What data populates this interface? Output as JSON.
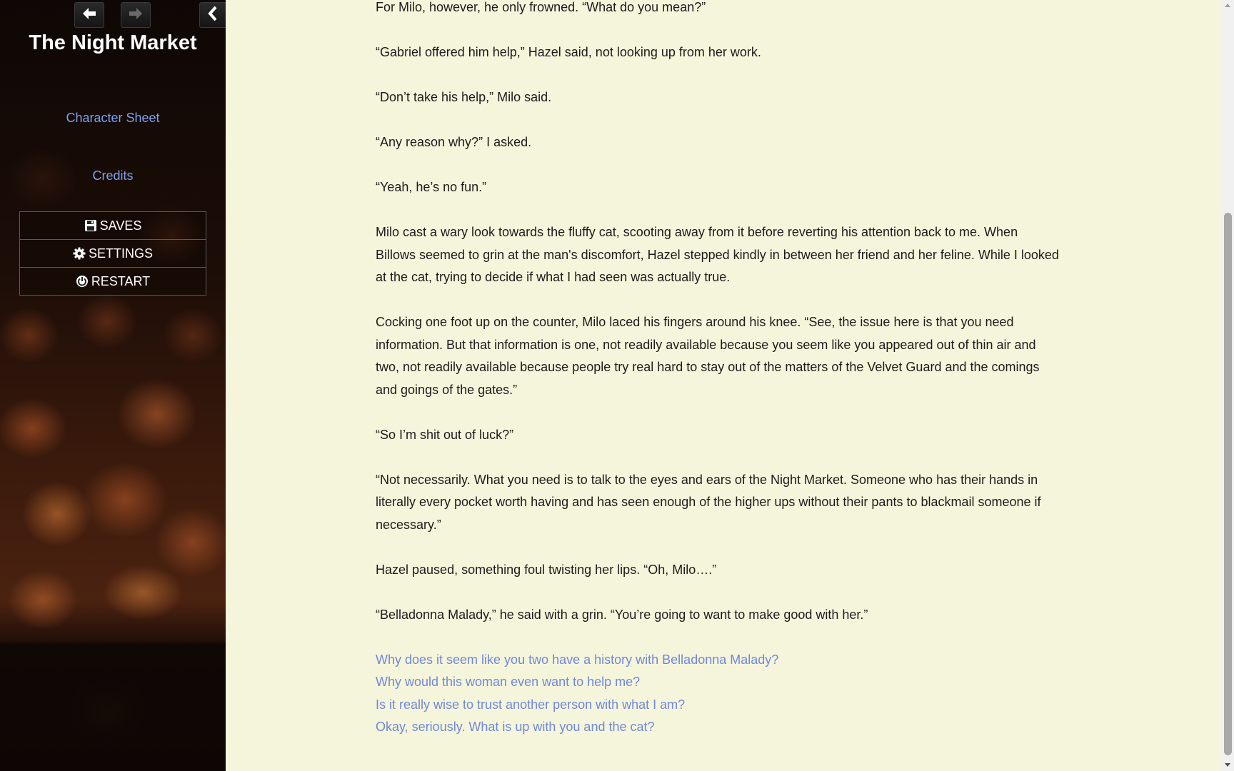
{
  "sidebar": {
    "title": "The Night Market",
    "links": {
      "character_sheet": "Character Sheet",
      "credits": "Credits"
    },
    "menu": {
      "saves": "SAVES",
      "settings": "SETTINGS",
      "restart": "RESTART"
    },
    "icons": {
      "back": "arrow-left-icon",
      "forward": "arrow-right-icon",
      "collapse": "chevron-left-icon",
      "saves": "floppy-disk-icon",
      "settings": "gear-icon",
      "restart": "power-icon"
    }
  },
  "story": {
    "paragraphs": [
      "For Milo, however, he only frowned. “What do you mean?”",
      "“Gabriel offered him help,” Hazel said, not looking up from her work.",
      "“Don’t take his help,” Milo said.",
      "“Any reason why?” I asked.",
      "“Yeah, he’s no fun.”",
      "Milo cast a wary look towards the fluffy cat, scooting away from it before reverting his attention back to me. When Billows seemed to grin at the man's discomfort, Hazel stepped kindly in between her friend and her feline. While I looked at the cat, trying to decide if what I had seen was actually true.",
      "Cocking one foot up on the counter, Milo laced his fingers around his knee. “See, the issue here is that you need information. But that information is one, not readily available because you seem like you appeared out of thin air and two, not readily available because people try real hard to stay out of the matters of the Velvet Guard and the comings and goings of the gates.”",
      "“So I’m shit out of luck?”",
      "“Not necessarily. What you need is to talk to the eyes and ears of the Night Market. Someone who has their hands in literally every pocket worth having and has seen enough of the higher ups without their pants to blackmail someone if necessary.”",
      "Hazel paused, something foul twisting her lips. “Oh, Milo….”",
      "“Belladonna Malady,” he said with a grin. “You’re going to want to make good with her.”"
    ],
    "choices": [
      "Why does it seem like you two have a history with Belladonna Malady?",
      "Why would this woman even want to help me?",
      "Is it really wise to trust another person with what I am?",
      "Okay, seriously. What is up with you and the cat?"
    ]
  },
  "colors": {
    "page_background": "#f5f5dc",
    "link": "#7ea0ee",
    "choice": "#7088d8",
    "text": "#1c1c1c"
  }
}
